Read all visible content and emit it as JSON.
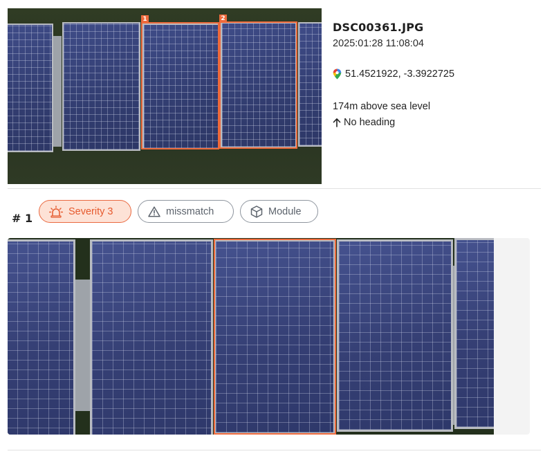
{
  "image": {
    "filename": "DSC00361.JPG",
    "timestamp": "2025:01:28 11:08:04",
    "coordinates": "51.4521922, -3.3922725",
    "altitude": "174m above sea level",
    "heading": "No heading",
    "location_icon": "map-pin-icon",
    "heading_icon": "arrow-up-icon",
    "bbox_labels": [
      "1",
      "2"
    ]
  },
  "detection": {
    "index": "# 1",
    "chips": {
      "severity": {
        "label": "Severity 3",
        "icon": "alarm-siren-icon"
      },
      "type": {
        "label": "missmatch",
        "icon": "warning-triangle-icon"
      },
      "category": {
        "label": "Module",
        "icon": "cube-icon"
      }
    }
  },
  "colors": {
    "accent": "#ee6a3c",
    "severity_bg": "#fde2d6",
    "chip_border": "#8e959e"
  }
}
